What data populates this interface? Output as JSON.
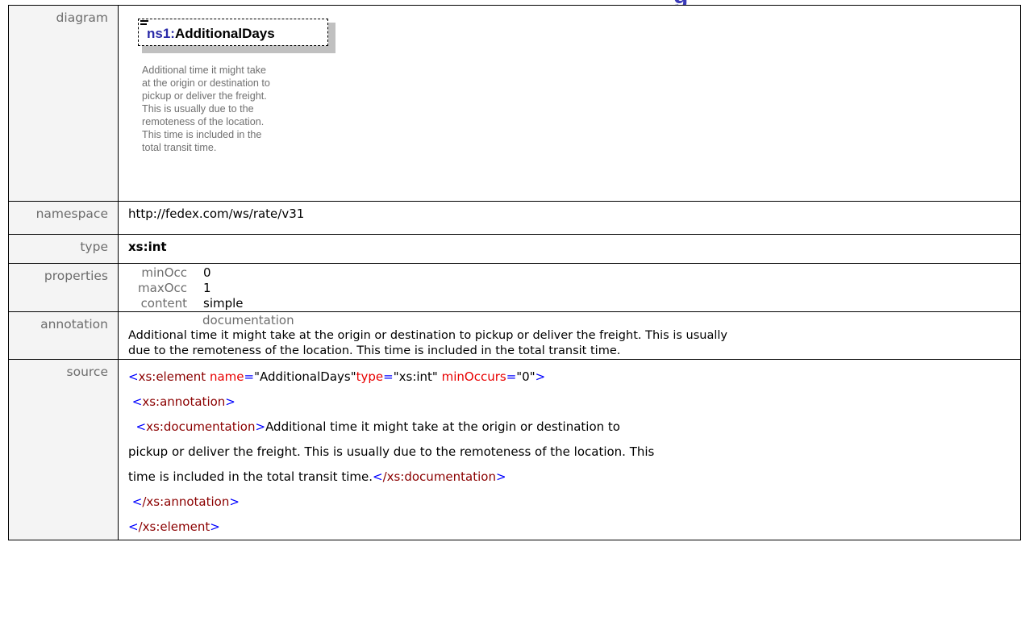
{
  "header": {
    "title_fragment": "g"
  },
  "diagram": {
    "label": "diagram",
    "element_prefix": "ns1:",
    "element_name": "AdditionalDays",
    "doc_lines": [
      "Additional time it might take",
      "at the origin or destination to",
      "pickup or deliver the freight.",
      "This is usually due to the",
      "remoteness of the location.",
      "This time is included in the",
      "total transit time."
    ]
  },
  "namespace": {
    "label": "namespace",
    "value": "http://fedex.com/ws/rate/v31"
  },
  "type": {
    "label": "type",
    "value": "xs:int"
  },
  "properties": {
    "label": "properties",
    "items": [
      {
        "key": "minOcc",
        "value": "0"
      },
      {
        "key": "maxOcc",
        "value": "1"
      },
      {
        "key": "content",
        "value": "simple"
      }
    ]
  },
  "annotation": {
    "label": "annotation",
    "sub_label": "documentation",
    "line1": "Additional time it might take at the origin or destination to pickup or deliver the freight. This is usually",
    "line2": "due to the remoteness of the location. This time is included in the total transit time."
  },
  "source": {
    "label": "source",
    "open_element": "xs:element",
    "attr_name": "name",
    "attr_name_val": "\"AdditionalDays\"",
    "attr_type": "type",
    "attr_type_val": "\"xs:int\"",
    "attr_min": "minOccurs",
    "attr_min_val": "\"0\"",
    "annotation_tag": "xs:annotation",
    "documentation_tag": "xs:documentation",
    "doc_text_1": "Additional time it might take at the origin or destination to",
    "doc_text_2": "pickup or deliver the freight. This is usually due to the remoteness of the location. This",
    "doc_text_3": "time is included in the total transit time.",
    "close_documentation": "/xs:documentation",
    "close_annotation": "/xs:annotation",
    "close_element": "/xs:element"
  },
  "colors": {
    "title": "#3a3ab8",
    "tag_bracket": "#0000ff",
    "tag_name": "#8b0000",
    "attr_name": "#e80000",
    "label_gray": "#6d6d6d"
  }
}
